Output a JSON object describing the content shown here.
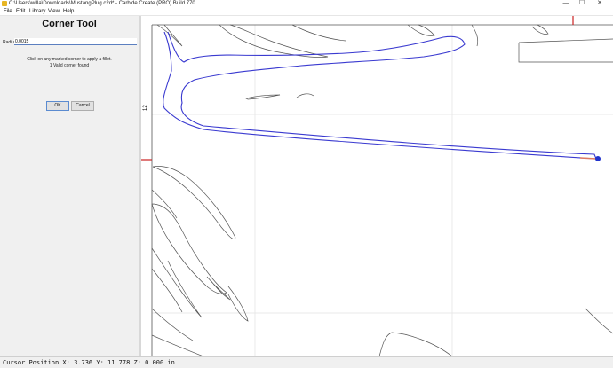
{
  "window": {
    "title": "C:\\Users\\willa\\Downloads\\MustangPlug.c2d* - Carbide Create (PRO) Build 770",
    "minimize": "—",
    "maximize": "☐",
    "close": "✕"
  },
  "menu": {
    "file": "File",
    "edit": "Edit",
    "library": "Library",
    "view": "View",
    "help": "Help"
  },
  "panel": {
    "title": "Corner Tool",
    "radius_label": "Radius",
    "radius_value": "0.0015",
    "hint": "Click on any marked corner to apply a fillet.",
    "corner_count": "1 Valid corner found",
    "ok_label": "OK",
    "cancel_label": "Cancel"
  },
  "canvas": {
    "ruler_label": "12",
    "selected_path_color": "#3a3ad0",
    "corner_marker_color": "#2233cc",
    "fillet_highlight_color": "#e07b62",
    "axis_color": "#cc2222"
  },
  "status": {
    "cursor_position": "Cursor Position X: 3.736 Y: 11.778 Z: 0.000 in"
  }
}
